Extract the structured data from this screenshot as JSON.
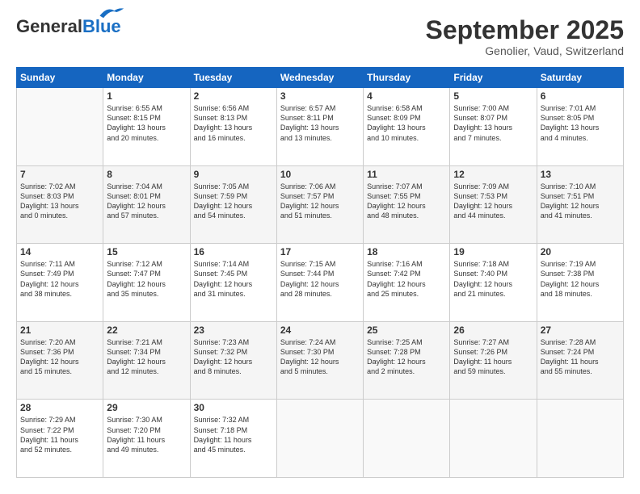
{
  "app": {
    "logo_general": "General",
    "logo_blue": "Blue",
    "title": "September 2025",
    "subtitle": "Genolier, Vaud, Switzerland"
  },
  "calendar": {
    "headers": [
      "Sunday",
      "Monday",
      "Tuesday",
      "Wednesday",
      "Thursday",
      "Friday",
      "Saturday"
    ],
    "rows": [
      [
        {
          "day": "",
          "info": ""
        },
        {
          "day": "1",
          "info": "Sunrise: 6:55 AM\nSunset: 8:15 PM\nDaylight: 13 hours\nand 20 minutes."
        },
        {
          "day": "2",
          "info": "Sunrise: 6:56 AM\nSunset: 8:13 PM\nDaylight: 13 hours\nand 16 minutes."
        },
        {
          "day": "3",
          "info": "Sunrise: 6:57 AM\nSunset: 8:11 PM\nDaylight: 13 hours\nand 13 minutes."
        },
        {
          "day": "4",
          "info": "Sunrise: 6:58 AM\nSunset: 8:09 PM\nDaylight: 13 hours\nand 10 minutes."
        },
        {
          "day": "5",
          "info": "Sunrise: 7:00 AM\nSunset: 8:07 PM\nDaylight: 13 hours\nand 7 minutes."
        },
        {
          "day": "6",
          "info": "Sunrise: 7:01 AM\nSunset: 8:05 PM\nDaylight: 13 hours\nand 4 minutes."
        }
      ],
      [
        {
          "day": "7",
          "info": "Sunrise: 7:02 AM\nSunset: 8:03 PM\nDaylight: 13 hours\nand 0 minutes."
        },
        {
          "day": "8",
          "info": "Sunrise: 7:04 AM\nSunset: 8:01 PM\nDaylight: 12 hours\nand 57 minutes."
        },
        {
          "day": "9",
          "info": "Sunrise: 7:05 AM\nSunset: 7:59 PM\nDaylight: 12 hours\nand 54 minutes."
        },
        {
          "day": "10",
          "info": "Sunrise: 7:06 AM\nSunset: 7:57 PM\nDaylight: 12 hours\nand 51 minutes."
        },
        {
          "day": "11",
          "info": "Sunrise: 7:07 AM\nSunset: 7:55 PM\nDaylight: 12 hours\nand 48 minutes."
        },
        {
          "day": "12",
          "info": "Sunrise: 7:09 AM\nSunset: 7:53 PM\nDaylight: 12 hours\nand 44 minutes."
        },
        {
          "day": "13",
          "info": "Sunrise: 7:10 AM\nSunset: 7:51 PM\nDaylight: 12 hours\nand 41 minutes."
        }
      ],
      [
        {
          "day": "14",
          "info": "Sunrise: 7:11 AM\nSunset: 7:49 PM\nDaylight: 12 hours\nand 38 minutes."
        },
        {
          "day": "15",
          "info": "Sunrise: 7:12 AM\nSunset: 7:47 PM\nDaylight: 12 hours\nand 35 minutes."
        },
        {
          "day": "16",
          "info": "Sunrise: 7:14 AM\nSunset: 7:45 PM\nDaylight: 12 hours\nand 31 minutes."
        },
        {
          "day": "17",
          "info": "Sunrise: 7:15 AM\nSunset: 7:44 PM\nDaylight: 12 hours\nand 28 minutes."
        },
        {
          "day": "18",
          "info": "Sunrise: 7:16 AM\nSunset: 7:42 PM\nDaylight: 12 hours\nand 25 minutes."
        },
        {
          "day": "19",
          "info": "Sunrise: 7:18 AM\nSunset: 7:40 PM\nDaylight: 12 hours\nand 21 minutes."
        },
        {
          "day": "20",
          "info": "Sunrise: 7:19 AM\nSunset: 7:38 PM\nDaylight: 12 hours\nand 18 minutes."
        }
      ],
      [
        {
          "day": "21",
          "info": "Sunrise: 7:20 AM\nSunset: 7:36 PM\nDaylight: 12 hours\nand 15 minutes."
        },
        {
          "day": "22",
          "info": "Sunrise: 7:21 AM\nSunset: 7:34 PM\nDaylight: 12 hours\nand 12 minutes."
        },
        {
          "day": "23",
          "info": "Sunrise: 7:23 AM\nSunset: 7:32 PM\nDaylight: 12 hours\nand 8 minutes."
        },
        {
          "day": "24",
          "info": "Sunrise: 7:24 AM\nSunset: 7:30 PM\nDaylight: 12 hours\nand 5 minutes."
        },
        {
          "day": "25",
          "info": "Sunrise: 7:25 AM\nSunset: 7:28 PM\nDaylight: 12 hours\nand 2 minutes."
        },
        {
          "day": "26",
          "info": "Sunrise: 7:27 AM\nSunset: 7:26 PM\nDaylight: 11 hours\nand 59 minutes."
        },
        {
          "day": "27",
          "info": "Sunrise: 7:28 AM\nSunset: 7:24 PM\nDaylight: 11 hours\nand 55 minutes."
        }
      ],
      [
        {
          "day": "28",
          "info": "Sunrise: 7:29 AM\nSunset: 7:22 PM\nDaylight: 11 hours\nand 52 minutes."
        },
        {
          "day": "29",
          "info": "Sunrise: 7:30 AM\nSunset: 7:20 PM\nDaylight: 11 hours\nand 49 minutes."
        },
        {
          "day": "30",
          "info": "Sunrise: 7:32 AM\nSunset: 7:18 PM\nDaylight: 11 hours\nand 45 minutes."
        },
        {
          "day": "",
          "info": ""
        },
        {
          "day": "",
          "info": ""
        },
        {
          "day": "",
          "info": ""
        },
        {
          "day": "",
          "info": ""
        }
      ]
    ]
  }
}
